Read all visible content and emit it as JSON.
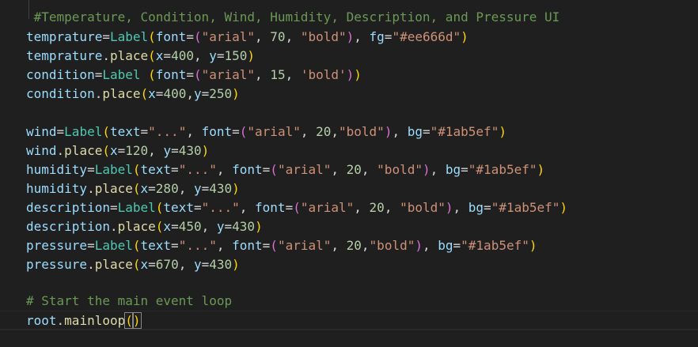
{
  "editor": {
    "lines": [
      [
        {
          "t": " #Temperature, Condition, Wind, Humidity, Description, and Pressure UI",
          "c": "c-comment"
        }
      ],
      [
        {
          "t": "temprature",
          "c": "c-var"
        },
        {
          "t": "=",
          "c": "c-op"
        },
        {
          "t": "Label",
          "c": "c-fn"
        },
        {
          "t": "(",
          "c": "c-b1"
        },
        {
          "t": "font",
          "c": "c-var"
        },
        {
          "t": "=",
          "c": "c-op"
        },
        {
          "t": "(",
          "c": "c-b2"
        },
        {
          "t": "\"arial\"",
          "c": "c-str"
        },
        {
          "t": ", ",
          "c": "c-plain"
        },
        {
          "t": "70",
          "c": "c-num"
        },
        {
          "t": ", ",
          "c": "c-plain"
        },
        {
          "t": "\"bold\"",
          "c": "c-str"
        },
        {
          "t": ")",
          "c": "c-b2"
        },
        {
          "t": ", ",
          "c": "c-plain"
        },
        {
          "t": "fg",
          "c": "c-var"
        },
        {
          "t": "=",
          "c": "c-op"
        },
        {
          "t": "\"#ee666d\"",
          "c": "c-str"
        },
        {
          "t": ")",
          "c": "c-b1"
        }
      ],
      [
        {
          "t": "temprature",
          "c": "c-var"
        },
        {
          "t": ".",
          "c": "c-plain"
        },
        {
          "t": "place",
          "c": "c-method"
        },
        {
          "t": "(",
          "c": "c-b1"
        },
        {
          "t": "x",
          "c": "c-var"
        },
        {
          "t": "=",
          "c": "c-op"
        },
        {
          "t": "400",
          "c": "c-num"
        },
        {
          "t": ", ",
          "c": "c-plain"
        },
        {
          "t": "y",
          "c": "c-var"
        },
        {
          "t": "=",
          "c": "c-op"
        },
        {
          "t": "150",
          "c": "c-num"
        },
        {
          "t": ")",
          "c": "c-b1"
        }
      ],
      [
        {
          "t": "condition",
          "c": "c-var"
        },
        {
          "t": "=",
          "c": "c-op"
        },
        {
          "t": "Label",
          "c": "c-fn"
        },
        {
          "t": " ",
          "c": "c-plain"
        },
        {
          "t": "(",
          "c": "c-b1"
        },
        {
          "t": "font",
          "c": "c-var"
        },
        {
          "t": "=",
          "c": "c-op"
        },
        {
          "t": "(",
          "c": "c-b2"
        },
        {
          "t": "\"arial\"",
          "c": "c-str"
        },
        {
          "t": ", ",
          "c": "c-plain"
        },
        {
          "t": "15",
          "c": "c-num"
        },
        {
          "t": ", ",
          "c": "c-plain"
        },
        {
          "t": "'bold'",
          "c": "c-str"
        },
        {
          "t": ")",
          "c": "c-b2"
        },
        {
          "t": ")",
          "c": "c-b1"
        }
      ],
      [
        {
          "t": "condition",
          "c": "c-var"
        },
        {
          "t": ".",
          "c": "c-plain"
        },
        {
          "t": "place",
          "c": "c-method"
        },
        {
          "t": "(",
          "c": "c-b1"
        },
        {
          "t": "x",
          "c": "c-var"
        },
        {
          "t": "=",
          "c": "c-op"
        },
        {
          "t": "400",
          "c": "c-num"
        },
        {
          "t": ",",
          "c": "c-plain"
        },
        {
          "t": "y",
          "c": "c-var"
        },
        {
          "t": "=",
          "c": "c-op"
        },
        {
          "t": "250",
          "c": "c-num"
        },
        {
          "t": ")",
          "c": "c-b1"
        }
      ],
      [],
      [
        {
          "t": "wind",
          "c": "c-var"
        },
        {
          "t": "=",
          "c": "c-op"
        },
        {
          "t": "Label",
          "c": "c-fn"
        },
        {
          "t": "(",
          "c": "c-b1"
        },
        {
          "t": "text",
          "c": "c-var"
        },
        {
          "t": "=",
          "c": "c-op"
        },
        {
          "t": "\"...\"",
          "c": "c-str"
        },
        {
          "t": ", ",
          "c": "c-plain"
        },
        {
          "t": "font",
          "c": "c-var"
        },
        {
          "t": "=",
          "c": "c-op"
        },
        {
          "t": "(",
          "c": "c-b2"
        },
        {
          "t": "\"arial\"",
          "c": "c-str"
        },
        {
          "t": ", ",
          "c": "c-plain"
        },
        {
          "t": "20",
          "c": "c-num"
        },
        {
          "t": ",",
          "c": "c-plain"
        },
        {
          "t": "\"bold\"",
          "c": "c-str"
        },
        {
          "t": ")",
          "c": "c-b2"
        },
        {
          "t": ", ",
          "c": "c-plain"
        },
        {
          "t": "bg",
          "c": "c-var"
        },
        {
          "t": "=",
          "c": "c-op"
        },
        {
          "t": "\"#1ab5ef\"",
          "c": "c-str"
        },
        {
          "t": ")",
          "c": "c-b1"
        }
      ],
      [
        {
          "t": "wind",
          "c": "c-var"
        },
        {
          "t": ".",
          "c": "c-plain"
        },
        {
          "t": "place",
          "c": "c-method"
        },
        {
          "t": "(",
          "c": "c-b1"
        },
        {
          "t": "x",
          "c": "c-var"
        },
        {
          "t": "=",
          "c": "c-op"
        },
        {
          "t": "120",
          "c": "c-num"
        },
        {
          "t": ", ",
          "c": "c-plain"
        },
        {
          "t": "y",
          "c": "c-var"
        },
        {
          "t": "=",
          "c": "c-op"
        },
        {
          "t": "430",
          "c": "c-num"
        },
        {
          "t": ")",
          "c": "c-b1"
        }
      ],
      [
        {
          "t": "humidity",
          "c": "c-var"
        },
        {
          "t": "=",
          "c": "c-op"
        },
        {
          "t": "Label",
          "c": "c-fn"
        },
        {
          "t": "(",
          "c": "c-b1"
        },
        {
          "t": "text",
          "c": "c-var"
        },
        {
          "t": "=",
          "c": "c-op"
        },
        {
          "t": "\"...\"",
          "c": "c-str"
        },
        {
          "t": ", ",
          "c": "c-plain"
        },
        {
          "t": "font",
          "c": "c-var"
        },
        {
          "t": "=",
          "c": "c-op"
        },
        {
          "t": "(",
          "c": "c-b2"
        },
        {
          "t": "\"arial\"",
          "c": "c-str"
        },
        {
          "t": ", ",
          "c": "c-plain"
        },
        {
          "t": "20",
          "c": "c-num"
        },
        {
          "t": ", ",
          "c": "c-plain"
        },
        {
          "t": "\"bold\"",
          "c": "c-str"
        },
        {
          "t": ")",
          "c": "c-b2"
        },
        {
          "t": ", ",
          "c": "c-plain"
        },
        {
          "t": "bg",
          "c": "c-var"
        },
        {
          "t": "=",
          "c": "c-op"
        },
        {
          "t": "\"#1ab5ef\"",
          "c": "c-str"
        },
        {
          "t": ")",
          "c": "c-b1"
        }
      ],
      [
        {
          "t": "humidity",
          "c": "c-var"
        },
        {
          "t": ".",
          "c": "c-plain"
        },
        {
          "t": "place",
          "c": "c-method"
        },
        {
          "t": "(",
          "c": "c-b1"
        },
        {
          "t": "x",
          "c": "c-var"
        },
        {
          "t": "=",
          "c": "c-op"
        },
        {
          "t": "280",
          "c": "c-num"
        },
        {
          "t": ", ",
          "c": "c-plain"
        },
        {
          "t": "y",
          "c": "c-var"
        },
        {
          "t": "=",
          "c": "c-op"
        },
        {
          "t": "430",
          "c": "c-num"
        },
        {
          "t": ")",
          "c": "c-b1"
        }
      ],
      [
        {
          "t": "description",
          "c": "c-var"
        },
        {
          "t": "=",
          "c": "c-op"
        },
        {
          "t": "Label",
          "c": "c-fn"
        },
        {
          "t": "(",
          "c": "c-b1"
        },
        {
          "t": "text",
          "c": "c-var"
        },
        {
          "t": "=",
          "c": "c-op"
        },
        {
          "t": "\"...\"",
          "c": "c-str"
        },
        {
          "t": ", ",
          "c": "c-plain"
        },
        {
          "t": "font",
          "c": "c-var"
        },
        {
          "t": "=",
          "c": "c-op"
        },
        {
          "t": "(",
          "c": "c-b2"
        },
        {
          "t": "\"arial\"",
          "c": "c-str"
        },
        {
          "t": ", ",
          "c": "c-plain"
        },
        {
          "t": "20",
          "c": "c-num"
        },
        {
          "t": ", ",
          "c": "c-plain"
        },
        {
          "t": "\"bold\"",
          "c": "c-str"
        },
        {
          "t": ")",
          "c": "c-b2"
        },
        {
          "t": ", ",
          "c": "c-plain"
        },
        {
          "t": "bg",
          "c": "c-var"
        },
        {
          "t": "=",
          "c": "c-op"
        },
        {
          "t": "\"#1ab5ef\"",
          "c": "c-str"
        },
        {
          "t": ")",
          "c": "c-b1"
        }
      ],
      [
        {
          "t": "description",
          "c": "c-var"
        },
        {
          "t": ".",
          "c": "c-plain"
        },
        {
          "t": "place",
          "c": "c-method"
        },
        {
          "t": "(",
          "c": "c-b1"
        },
        {
          "t": "x",
          "c": "c-var"
        },
        {
          "t": "=",
          "c": "c-op"
        },
        {
          "t": "450",
          "c": "c-num"
        },
        {
          "t": ", ",
          "c": "c-plain"
        },
        {
          "t": "y",
          "c": "c-var"
        },
        {
          "t": "=",
          "c": "c-op"
        },
        {
          "t": "430",
          "c": "c-num"
        },
        {
          "t": ")",
          "c": "c-b1"
        }
      ],
      [
        {
          "t": "pressure",
          "c": "c-var"
        },
        {
          "t": "=",
          "c": "c-op"
        },
        {
          "t": "Label",
          "c": "c-fn"
        },
        {
          "t": "(",
          "c": "c-b1"
        },
        {
          "t": "text",
          "c": "c-var"
        },
        {
          "t": "=",
          "c": "c-op"
        },
        {
          "t": "\"...\"",
          "c": "c-str"
        },
        {
          "t": ", ",
          "c": "c-plain"
        },
        {
          "t": "font",
          "c": "c-var"
        },
        {
          "t": "=",
          "c": "c-op"
        },
        {
          "t": "(",
          "c": "c-b2"
        },
        {
          "t": "\"arial\"",
          "c": "c-str"
        },
        {
          "t": ", ",
          "c": "c-plain"
        },
        {
          "t": "20",
          "c": "c-num"
        },
        {
          "t": ",",
          "c": "c-plain"
        },
        {
          "t": "\"bold\"",
          "c": "c-str"
        },
        {
          "t": ")",
          "c": "c-b2"
        },
        {
          "t": ", ",
          "c": "c-plain"
        },
        {
          "t": "bg",
          "c": "c-var"
        },
        {
          "t": "=",
          "c": "c-op"
        },
        {
          "t": "\"#1ab5ef\"",
          "c": "c-str"
        },
        {
          "t": ")",
          "c": "c-b1"
        }
      ],
      [
        {
          "t": "pressure",
          "c": "c-var"
        },
        {
          "t": ".",
          "c": "c-plain"
        },
        {
          "t": "place",
          "c": "c-method"
        },
        {
          "t": "(",
          "c": "c-b1"
        },
        {
          "t": "x",
          "c": "c-var"
        },
        {
          "t": "=",
          "c": "c-op"
        },
        {
          "t": "670",
          "c": "c-num"
        },
        {
          "t": ", ",
          "c": "c-plain"
        },
        {
          "t": "y",
          "c": "c-var"
        },
        {
          "t": "=",
          "c": "c-op"
        },
        {
          "t": "430",
          "c": "c-num"
        },
        {
          "t": ")",
          "c": "c-b1"
        }
      ],
      [],
      [
        {
          "t": "# Start the main event loop",
          "c": "c-comment"
        }
      ],
      [
        {
          "t": "root",
          "c": "c-var"
        },
        {
          "t": ".",
          "c": "c-plain"
        },
        {
          "t": "mainloop",
          "c": "c-method"
        },
        {
          "t": "(",
          "c": "c-b1 cursor-box"
        },
        {
          "t": ")",
          "c": "c-b1 cursor-box"
        }
      ]
    ],
    "current_line_index": 16
  }
}
